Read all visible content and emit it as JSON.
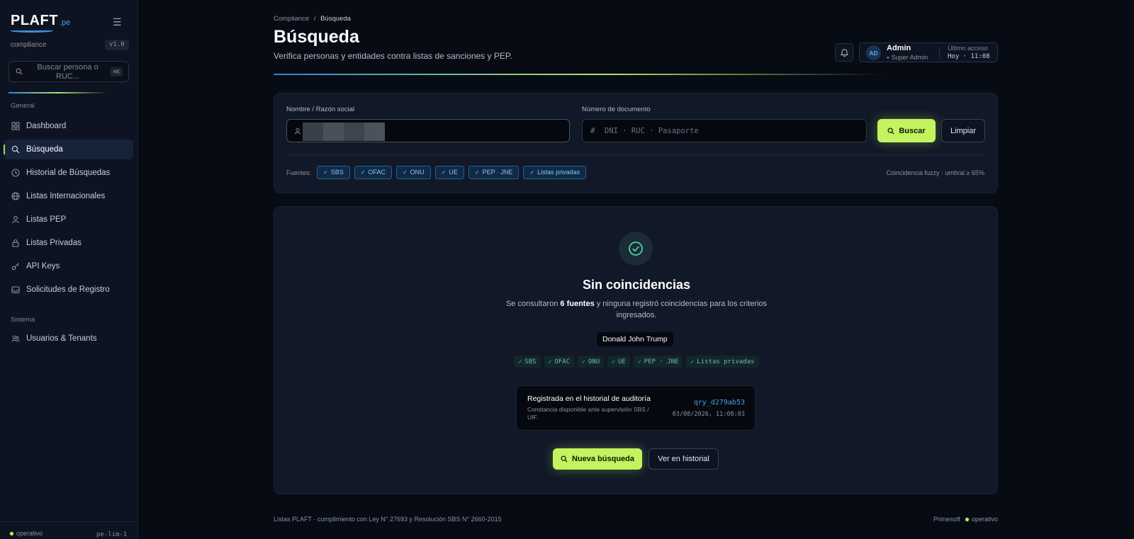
{
  "sidebar": {
    "logo_main": "PLAFT",
    "logo_suffix": ".pe",
    "subtitle": "compliance",
    "version": "v1.0",
    "search_placeholder": "Buscar persona o RUC...",
    "search_shortcut": "⌘K",
    "section_general": "General",
    "section_system": "Sistema",
    "items": [
      {
        "label": "Dashboard",
        "icon": "grid-icon"
      },
      {
        "label": "Búsqueda",
        "icon": "search-icon",
        "active": true
      },
      {
        "label": "Historial de Búsquedas",
        "icon": "clock-icon"
      },
      {
        "label": "Listas Internacionales",
        "icon": "globe-icon"
      },
      {
        "label": "Listas PEP",
        "icon": "user-icon"
      },
      {
        "label": "Listas Privadas",
        "icon": "lock-icon"
      },
      {
        "label": "API Keys",
        "icon": "key-icon"
      },
      {
        "label": "Solicitudes de Registro",
        "icon": "inbox-icon"
      }
    ],
    "system_items": [
      {
        "label": "Usuarios & Tenants",
        "icon": "users-icon"
      }
    ],
    "status": "operativo",
    "node": "pe-lim-1"
  },
  "header": {
    "breadcrumb_parent": "Compliance",
    "breadcrumb_separator": "/",
    "breadcrumb_current": "Búsqueda",
    "title": "Búsqueda",
    "subtitle": "Verifica personas y entidades contra listas de sanciones y PEP.",
    "user": {
      "initials": "AD",
      "name": "Admin",
      "role": "Super Admin",
      "last_access_label": "Último acceso",
      "last_access_value": "Hoy · 11:08"
    }
  },
  "search": {
    "name_label": "Nombre / Razón social",
    "doc_label": "Número de documento",
    "doc_placeholder": "DNI · RUC · Pasaporte",
    "search_button": "Buscar",
    "clear_button": "Limpiar",
    "sources_label": "Fuentes:",
    "sources": [
      "SBS",
      "OFAC",
      "ONU",
      "UE",
      "PEP · JNE",
      "Listas privadas"
    ],
    "fuzzy_note": "Coincidencia fuzzy · umbral ≥ 65%"
  },
  "result": {
    "title": "Sin coincidencias",
    "desc_prefix": "Se consultaron ",
    "desc_bold": "6 fuentes",
    "desc_suffix": " y ninguna registró coincidencias para los criterios ingresados.",
    "query_name": "Donald John Trump",
    "sources": [
      "SBS",
      "OFAC",
      "ONU",
      "UE",
      "PEP · JNE",
      "Listas privadas"
    ],
    "audit_title": "Registrada en el historial de auditoría",
    "audit_sub": "Constancia disponible ante supervisión SBS / UIF.",
    "audit_id": "qry_d279ab53",
    "audit_date": "03/08/2026, 11:08:03",
    "new_search_button": "Nueva búsqueda",
    "history_button": "Ver en historial"
  },
  "footer": {
    "left": "Listas PLAFT · cumplimiento con Ley N° 27693 y Resolución SBS N° 2660-2015",
    "brand": "Primesoft",
    "status": "operativo"
  },
  "colors": {
    "accent": "#c3f35f",
    "link": "#4aa3e8",
    "background": "#070b14",
    "panel": "#111827"
  }
}
